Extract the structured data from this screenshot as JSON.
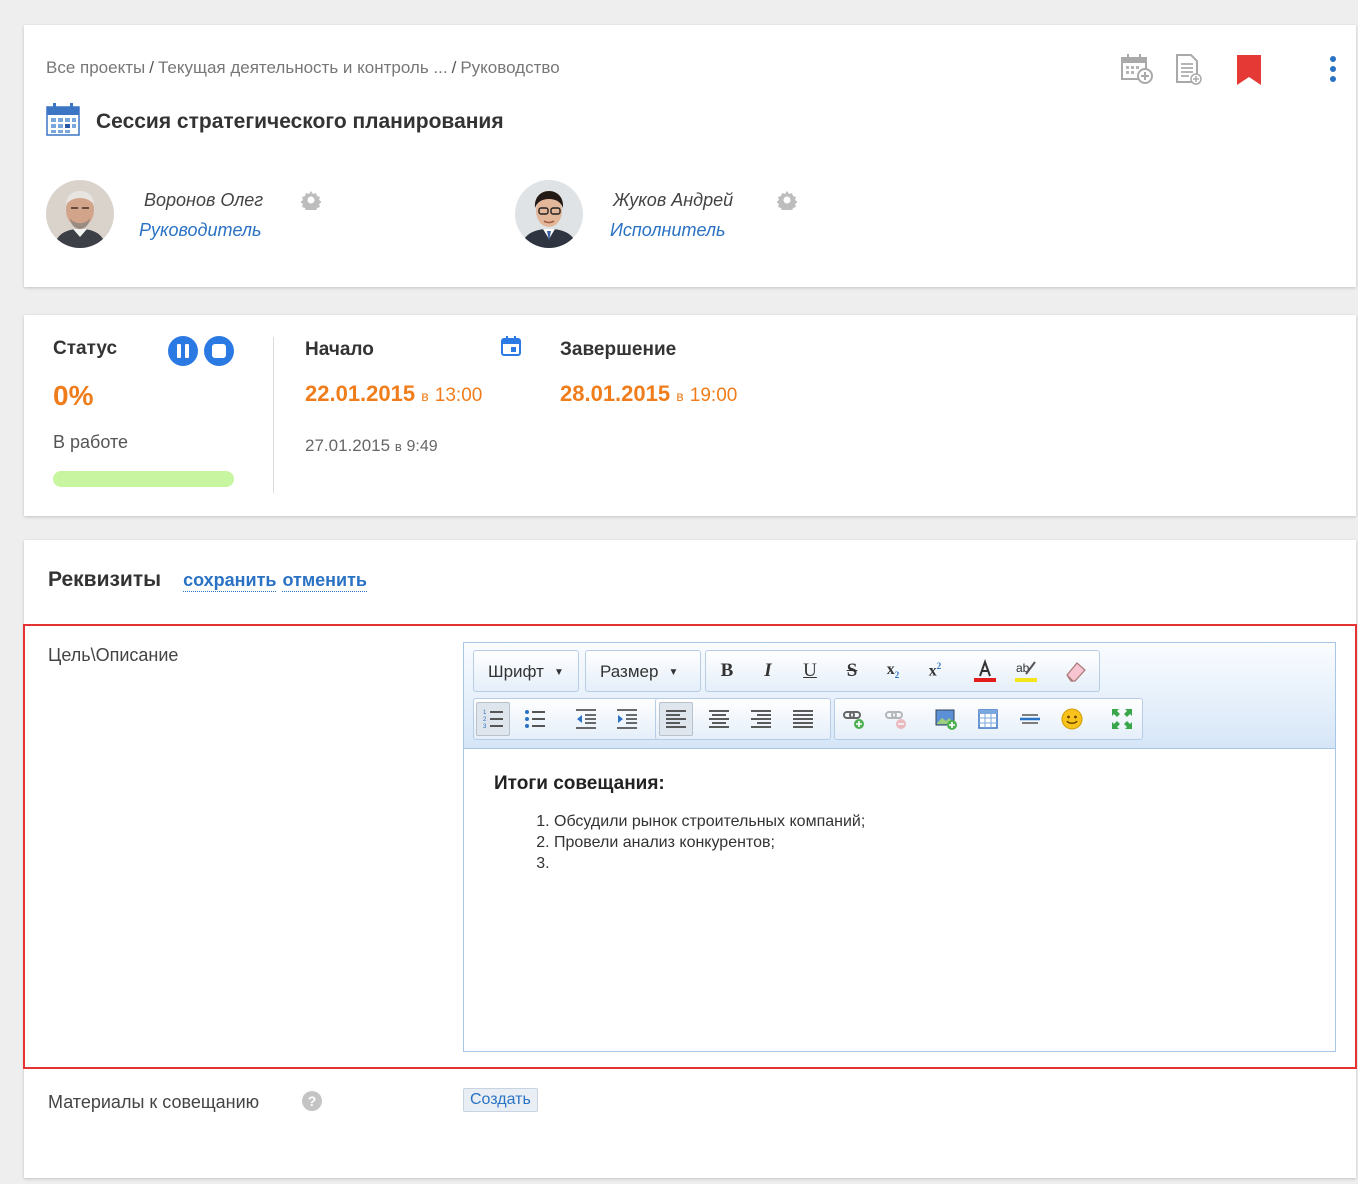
{
  "header": {
    "breadcrumb": [
      "Все проекты",
      "Текущая деятельность и контроль ...",
      "Руководство"
    ],
    "title": "Сессия стратегического планирования",
    "people": [
      {
        "name": "Воронов Олег",
        "role": "Руководитель"
      },
      {
        "name": "Жуков Андрей",
        "role": "Исполнитель"
      }
    ]
  },
  "status": {
    "label": "Статус",
    "percent": "0%",
    "state": "В работе",
    "progress_fraction": 0.0,
    "start_label": "Начало",
    "start_date": "22.01.2015",
    "start_in": "в",
    "start_time": "13:00",
    "actual_start_date": "27.01.2015",
    "actual_start_in": "в",
    "actual_start_time": "9:49",
    "end_label": "Завершение",
    "end_date": "28.01.2015",
    "end_in": "в",
    "end_time": "19:00"
  },
  "props": {
    "title": "Реквизиты",
    "save": "сохранить",
    "cancel": "отменить",
    "goal_label": "Цель\\Описание",
    "materials_label": "Материалы к совещанию",
    "create_button": "Создать"
  },
  "editor": {
    "font_dropdown": "Шрифт",
    "size_dropdown": "Размер",
    "heading": "Итоги совещания:",
    "list_items": [
      "Обсудили рынок строительных компаний;",
      "Провели анализ конкурентов;",
      ""
    ]
  },
  "colors": {
    "accent": "#2a72c4",
    "orange": "#f07d1b",
    "bookmark": "#e53935",
    "highlight_frame": "#e53333",
    "progress": "#c8f5a0"
  }
}
